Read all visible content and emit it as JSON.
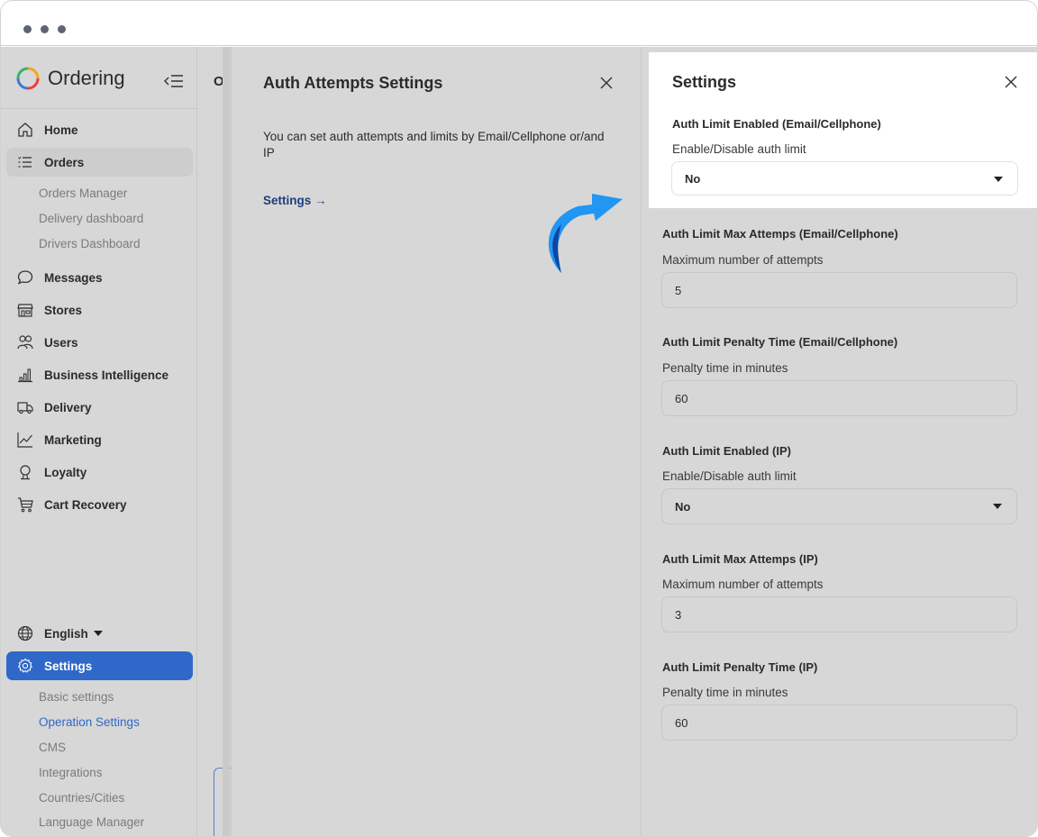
{
  "sidebar": {
    "brand": "Ordering",
    "items": [
      {
        "label": "Home",
        "icon": "home-icon"
      },
      {
        "label": "Orders",
        "icon": "list-icon"
      },
      {
        "label": "Messages",
        "icon": "chat-icon"
      },
      {
        "label": "Stores",
        "icon": "store-icon"
      },
      {
        "label": "Users",
        "icon": "users-icon"
      },
      {
        "label": "Business Intelligence",
        "icon": "bar-chart-icon"
      },
      {
        "label": "Delivery",
        "icon": "truck-icon"
      },
      {
        "label": "Marketing",
        "icon": "trend-icon"
      },
      {
        "label": "Loyalty",
        "icon": "award-icon"
      },
      {
        "label": "Cart Recovery",
        "icon": "cart-icon"
      }
    ],
    "orders_sub": [
      "Orders Manager",
      "Delivery dashboard",
      "Drivers Dashboard"
    ],
    "language": "English",
    "settings_label": "Settings",
    "settings_sub": [
      "Basic settings",
      "Operation Settings",
      "CMS",
      "Integrations",
      "Countries/Cities",
      "Language Manager"
    ]
  },
  "strip": {
    "text": "O"
  },
  "auth_panel": {
    "title": "Auth Attempts Settings",
    "description": "You can set auth attempts and limits by Email/Cellphone or/and IP",
    "link": "Settings →"
  },
  "settings_panel": {
    "title": "Settings",
    "fields": [
      {
        "label": "Auth Limit Enabled (Email/Cellphone)",
        "help": "Enable/Disable auth limit",
        "value": "No"
      },
      {
        "label": "Auth Limit Max Attemps (Email/Cellphone)",
        "help": "Maximum number of attempts",
        "value": "5"
      },
      {
        "label": "Auth Limit Penalty Time (Email/Cellphone)",
        "help": "Penalty time in minutes",
        "value": "60"
      },
      {
        "label": "Auth Limit Enabled (IP)",
        "help": "Enable/Disable auth limit",
        "value": "No"
      },
      {
        "label": "Auth Limit Max Attemps (IP)",
        "help": "Maximum number of attempts",
        "value": "3"
      },
      {
        "label": "Auth Limit Penalty Time (IP)",
        "help": "Penalty time in minutes",
        "value": "60"
      }
    ]
  },
  "colors": {
    "accent": "#2f68c8",
    "arrow": "#2196f3",
    "link": "#1e3d7a"
  }
}
